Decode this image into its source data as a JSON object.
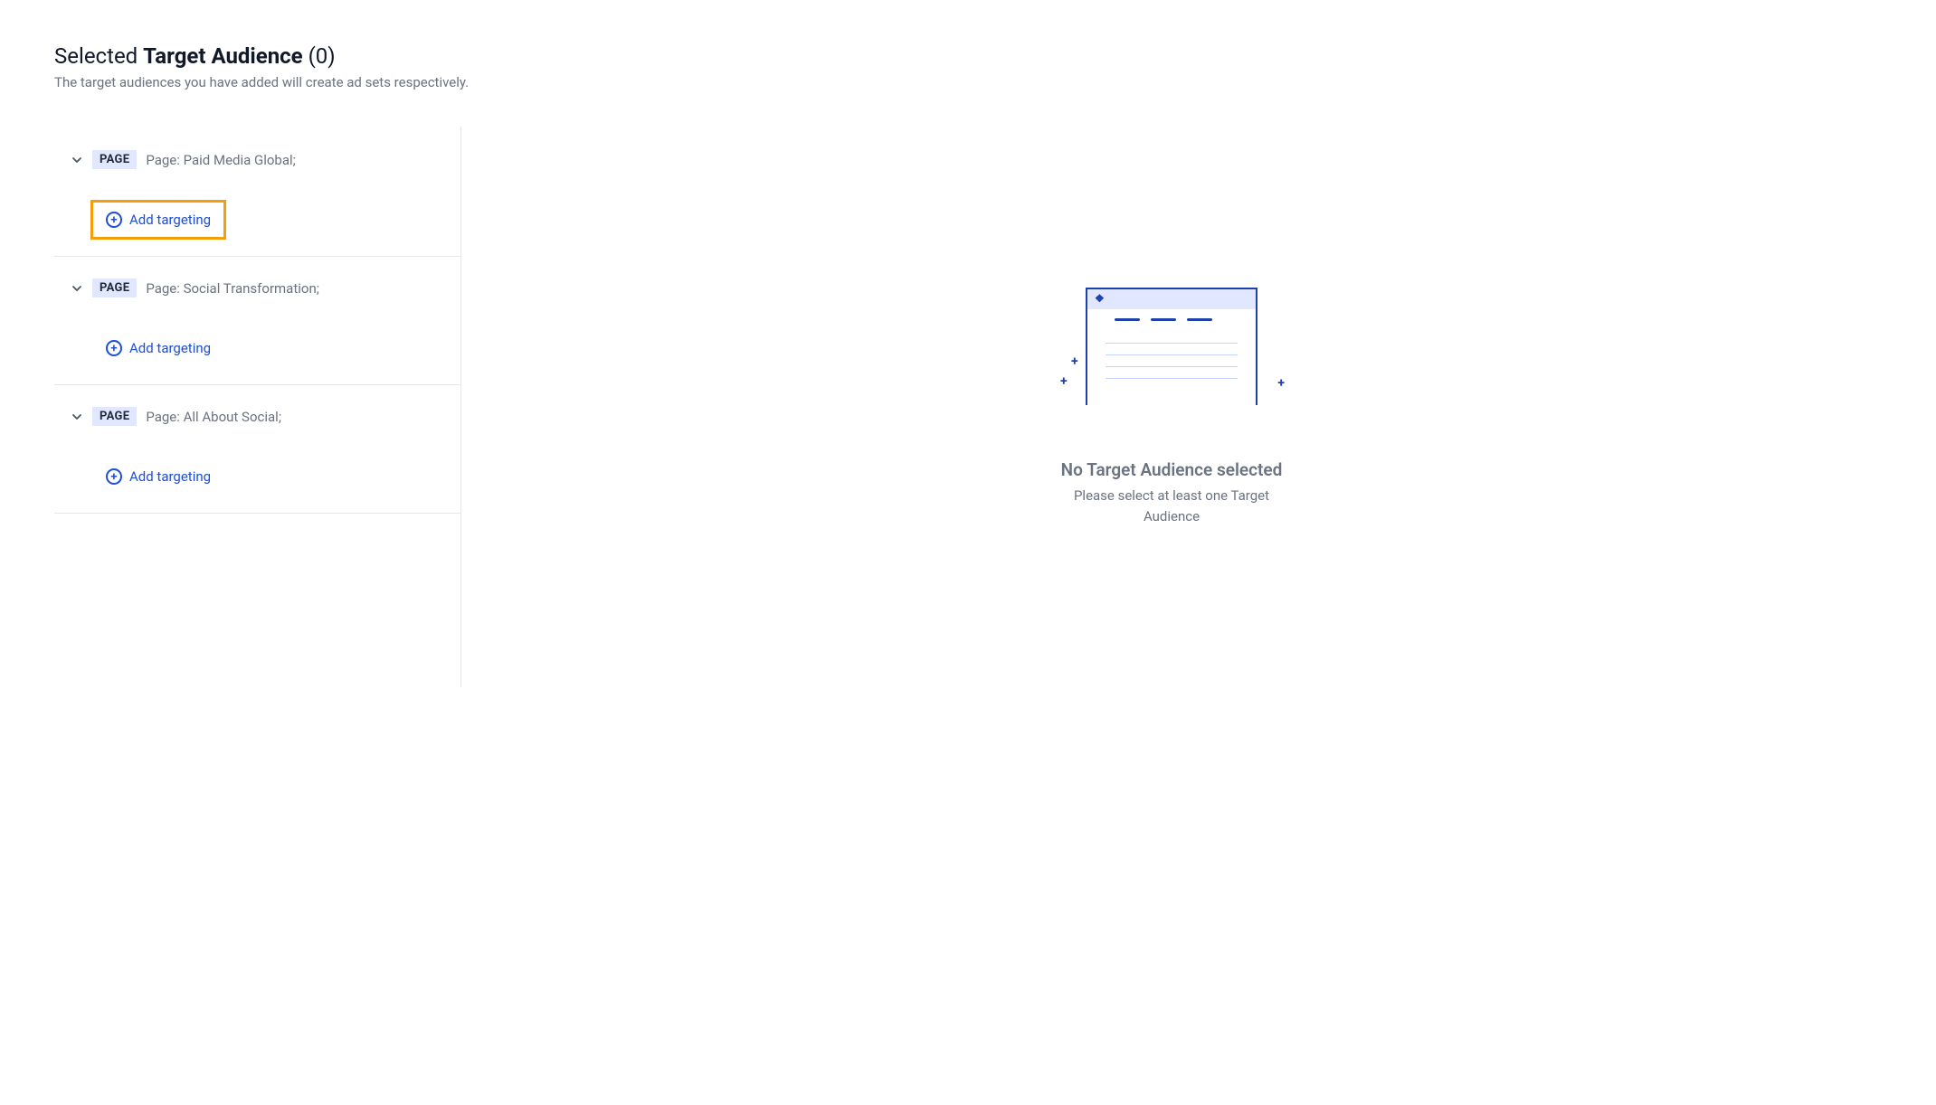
{
  "header": {
    "title_prefix": "Selected ",
    "title_bold": "Target Audience",
    "title_suffix": " (0)",
    "subtitle": "The target audiences you have added will create ad sets respectively."
  },
  "badge_label": "PAGE",
  "add_targeting_label": "Add targeting",
  "pages": [
    {
      "label": "Page: Paid Media Global;",
      "highlighted": true
    },
    {
      "label": "Page: Social Transformation;",
      "highlighted": false
    },
    {
      "label": "Page: All About Social;",
      "highlighted": false
    }
  ],
  "empty_state": {
    "title": "No Target Audience selected",
    "subtitle": "Please select at least one Target Audience"
  }
}
